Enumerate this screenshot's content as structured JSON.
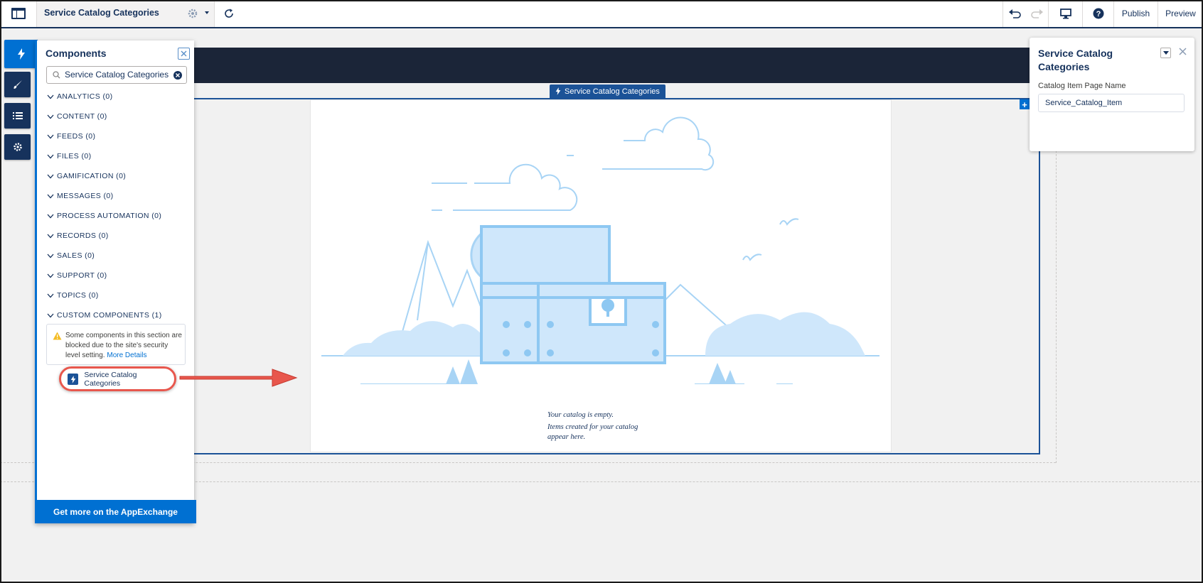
{
  "topbar": {
    "title": "Service Catalog Categories",
    "publish_label": "Publish",
    "preview_label": "Preview"
  },
  "components_panel": {
    "title": "Components",
    "search_value": "Service Catalog Categories",
    "categories": [
      "ANALYTICS (0)",
      "CONTENT (0)",
      "FEEDS (0)",
      "FILES (0)",
      "GAMIFICATION (0)",
      "MESSAGES (0)",
      "PROCESS AUTOMATION (0)",
      "RECORDS (0)",
      "SALES (0)",
      "SUPPORT (0)",
      "TOPICS (0)",
      "CUSTOM COMPONENTS (1)"
    ],
    "warning_text": "Some components in this section are blocked due to the site's security level setting.",
    "warning_link": "More Details",
    "custom_component": "Service Catalog Categories",
    "footer": "Get more on the AppExchange"
  },
  "canvas": {
    "component_tag": "Service Catalog Categories",
    "empty_line1": "Your catalog is empty.",
    "empty_line2": "Items created for your catalog",
    "empty_line3": "appear here."
  },
  "property_panel": {
    "title": "Service Catalog Categories",
    "field_label": "Catalog Item Page Name",
    "field_value": "Service_Catalog_Item"
  },
  "colors": {
    "brand_blue": "#0070d2",
    "navy": "#16325c",
    "banner": "#1b2538",
    "illustration": "#a8d4f5",
    "callout_red": "#e8574d"
  }
}
